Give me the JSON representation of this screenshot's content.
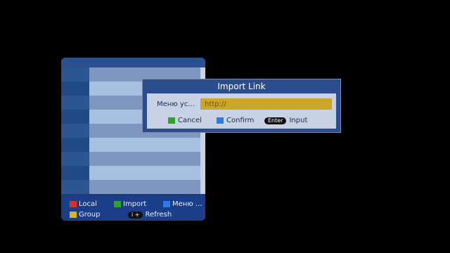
{
  "colors": {
    "background": "#000000",
    "panel": "#1f3c7a",
    "dialog": "#2a4d8e",
    "dialog_body": "#c9d2e4",
    "url_bg": "#caa629",
    "red": "#d43030",
    "green": "#2aa62a",
    "blue": "#2b7be4",
    "yellow": "#d6b51c"
  },
  "left_panel": {
    "legend": {
      "local": "Local",
      "import": "Import",
      "menu": "Меню ...",
      "group": "Group",
      "refresh_key": "i +",
      "refresh": "Refresh"
    }
  },
  "dialog": {
    "title": "Import Link",
    "row_label": "Меню ус...",
    "url_value": "http://",
    "buttons": {
      "cancel": "Cancel",
      "confirm": "Confirm",
      "enter_key": "Enter",
      "input": "Input"
    }
  }
}
